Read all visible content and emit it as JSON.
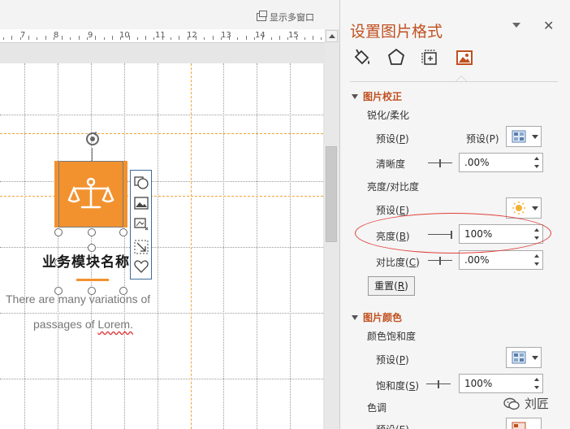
{
  "topbar": {
    "show_multi_window": "显示多窗口"
  },
  "ruler": {
    "numbers": [
      "7",
      "8",
      "9",
      "10",
      "11",
      "12",
      "13",
      "14",
      "15"
    ]
  },
  "slide": {
    "module_title": "业务模块名称",
    "description_line1": "There are many variations of",
    "description_line2_a": "passages of ",
    "description_line2_b": "Lorem."
  },
  "panel": {
    "title": "设置图片格式",
    "tabs": [
      {
        "name": "fill-line",
        "icon": "paint-bucket-icon"
      },
      {
        "name": "effects",
        "icon": "pentagon-icon"
      },
      {
        "name": "size-properties",
        "icon": "size-icon"
      },
      {
        "name": "picture",
        "icon": "picture-icon",
        "active": true
      }
    ],
    "correction": {
      "header": "图片校正",
      "sharpen_soften": "锐化/柔化",
      "preset_label_a": "预设(",
      "preset_key": "P",
      "preset_label_b": ")",
      "preset_right_label": "预设(P)",
      "sharpness_label": "清晰度",
      "sharpness_value": ".00%",
      "brightness_contrast": "亮度/对比度",
      "preset2_label_a": "预设(",
      "preset2_key": "E",
      "preset2_label_b": ")",
      "brightness_label_a": "亮度(",
      "brightness_key": "B",
      "brightness_label_b": ")",
      "brightness_value": "100%",
      "contrast_label_a": "对比度(",
      "contrast_key": "C",
      "contrast_label_b": ")",
      "contrast_value": ".00%",
      "reset_label_a": "重置(",
      "reset_key": "R",
      "reset_label_b": ")"
    },
    "color": {
      "header": "图片颜色",
      "saturation_group": "颜色饱和度",
      "preset_label_a": "预设(",
      "preset_key": "P",
      "preset_label_b": ")",
      "saturation_label_a": "饱和度(",
      "saturation_key": "S",
      "saturation_label_b": ")",
      "saturation_value": "100%",
      "tone_group": "色调",
      "tone_preset_label": "预设(E)"
    }
  },
  "watermark": {
    "text": "刘匠"
  },
  "colors": {
    "accent": "#c0501f",
    "icon_fill": "#f2922f",
    "highlight": "#e0403a"
  }
}
